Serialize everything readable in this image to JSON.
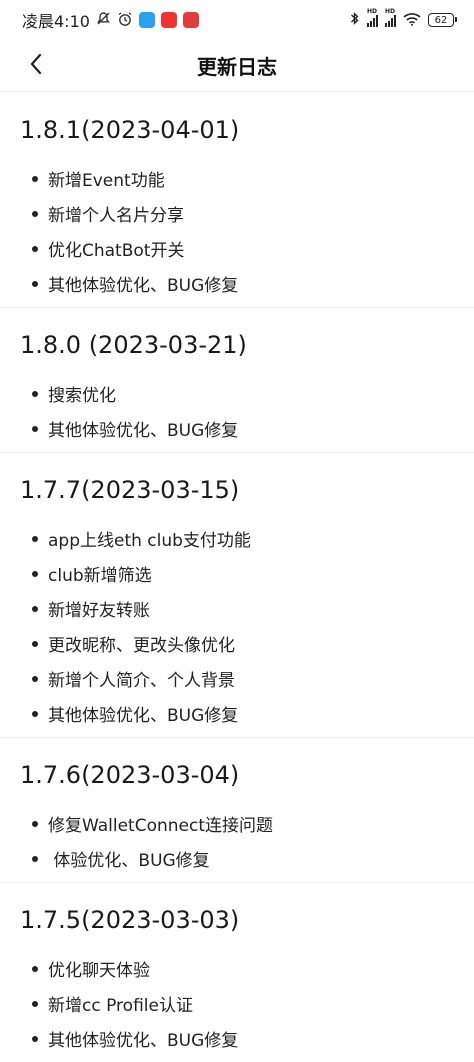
{
  "status_bar": {
    "time": "凌晨4:10",
    "battery": "62",
    "icons": [
      "mute-icon",
      "alarm-icon",
      "app-icon-blue",
      "app-icon-red",
      "app-icon-red-2",
      "bluetooth-icon",
      "signal-icon",
      "signal-icon-2",
      "wifi-icon"
    ],
    "colors": {
      "app_blue": "#2aa0f0",
      "app_red": "#ee3333",
      "app_red2": "#e23b3b"
    },
    "hd_label": "HD"
  },
  "nav": {
    "title": "更新日志",
    "back_icon": "chevron-left-icon"
  },
  "changelog": [
    {
      "version": "1.8.1(2023-04-01)",
      "items": [
        "新增Event功能",
        "新增个人名片分享",
        "优化ChatBot开关",
        "其他体验优化、BUG修复"
      ]
    },
    {
      "version": "1.8.0 (2023-03-21)",
      "items": [
        "搜索优化",
        "其他体验优化、BUG修复"
      ]
    },
    {
      "version": "1.7.7(2023-03-15)",
      "items": [
        "app上线eth club支付功能",
        "club新增筛选",
        "新增好友转账",
        "更改昵称、更改头像优化",
        "新增个人简介、个人背景",
        "其他体验优化、BUG修复"
      ]
    },
    {
      "version": "1.7.6(2023-03-04)",
      "items": [
        "修复WalletConnect连接问题",
        " 体验优化、BUG修复"
      ]
    },
    {
      "version": "1.7.5(2023-03-03)",
      "items": [
        "优化聊天体验",
        "新增cc Profile认证",
        "其他体验优化、BUG修复"
      ]
    }
  ]
}
